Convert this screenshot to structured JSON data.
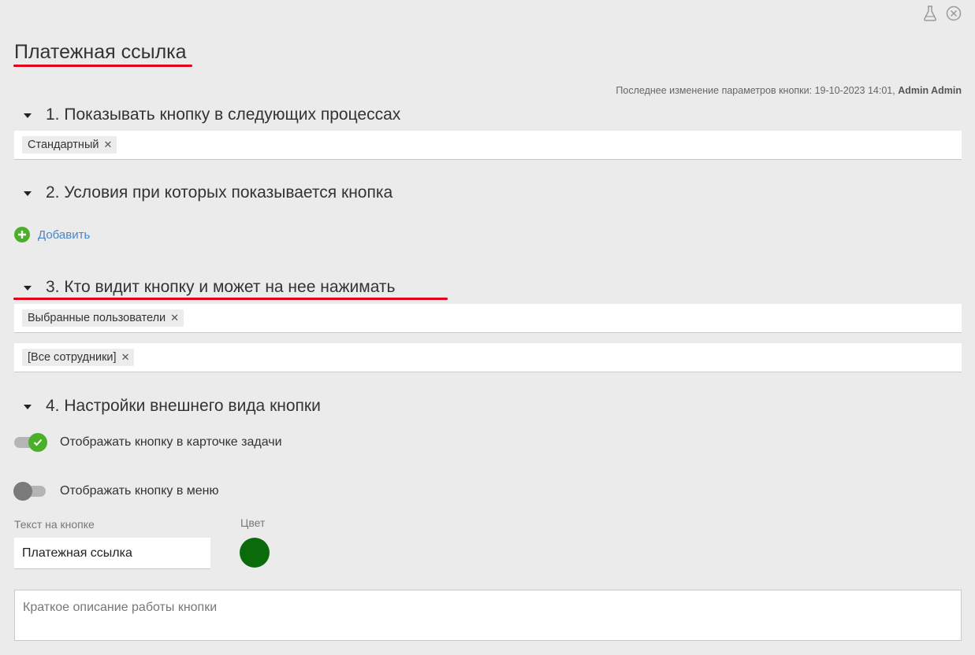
{
  "header": {
    "title": "Платежная ссылка",
    "meta_text": "Последнее изменение параметров кнопки: 19-10-2023 14:01,",
    "meta_user": "Admin Admin",
    "icons": [
      "flask-icon",
      "close-circle-icon"
    ]
  },
  "sections": [
    {
      "title": "1. Показывать кнопку в следующих процессах"
    },
    {
      "title": "2. Условия при которых показывается кнопка"
    },
    {
      "title": "3. Кто видит кнопку и может на нее нажимать"
    },
    {
      "title": "4. Настройки внешнего вида кнопки"
    }
  ],
  "processes": {
    "tags": [
      "Стандартный"
    ]
  },
  "conditions": {
    "add_label": "Добавить"
  },
  "visibility": {
    "type_tags": [
      "Выбранные пользователи"
    ],
    "user_tags": [
      "[Все сотрудники]"
    ]
  },
  "appearance": {
    "toggle_card_label": "Отображать кнопку в карточке задачи",
    "toggle_card_on": true,
    "toggle_menu_label": "Отображать кнопку в меню",
    "toggle_menu_on": false,
    "button_text_label": "Текст на кнопке",
    "button_text_value": "Платежная ссылка",
    "color_label": "Цвет",
    "color_value": "#0b6b0b",
    "description_placeholder": "Краткое описание работы кнопки"
  },
  "colors": {
    "accent_green": "#4caf2a",
    "link_blue": "#4a86c6",
    "highlight_red": "#e0001b"
  }
}
